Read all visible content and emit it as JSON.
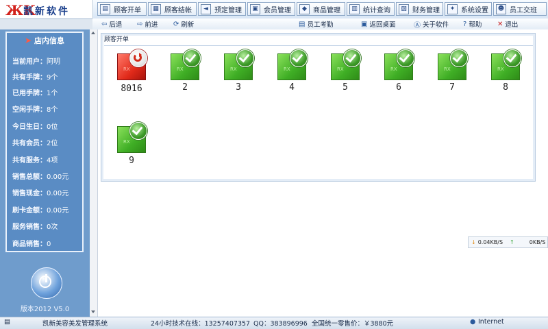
{
  "app": {
    "logo_mark": "ЖK",
    "logo_text": "凯新软件",
    "version": "版本2012 V5.0"
  },
  "top_menu": [
    {
      "label": "顾客开单",
      "icon": "clipboard-icon"
    },
    {
      "label": "顾客结帐",
      "icon": "checkout-icon"
    },
    {
      "label": "预定管理",
      "icon": "speaker-icon"
    },
    {
      "label": "会员管理",
      "icon": "member-card-icon"
    },
    {
      "label": "商品管理",
      "icon": "goods-icon"
    },
    {
      "label": "统计查询",
      "icon": "stats-icon"
    },
    {
      "label": "财务管理",
      "icon": "finance-icon"
    },
    {
      "label": "系统设置",
      "icon": "settings-icon"
    },
    {
      "label": "员工交班",
      "icon": "handover-icon"
    }
  ],
  "sub_toolbar": {
    "back": "后退",
    "forward": "前进",
    "refresh": "刷新",
    "attendance": "员工考勤",
    "home": "返回桌面",
    "about": "关于软件",
    "help": "帮助",
    "exit": "退出"
  },
  "store_info": {
    "title": "店内信息",
    "rows": [
      {
        "key": "当前用户：",
        "value": "阿明"
      },
      {
        "key": "共有手牌：",
        "value": "9个"
      },
      {
        "key": "已用手牌：",
        "value": "1个"
      },
      {
        "key": "空闲手牌：",
        "value": "8个"
      },
      {
        "key": "今日生日：",
        "value": "0位"
      },
      {
        "key": "共有会员：",
        "value": "2位"
      },
      {
        "key": "共有服务：",
        "value": "4项"
      },
      {
        "key": "销售总额：",
        "value": "0.00元"
      },
      {
        "key": "销售现金：",
        "value": "0.00元"
      },
      {
        "key": "刷卡金额：",
        "value": "0.00元"
      },
      {
        "key": "服务销售：",
        "value": "0次"
      },
      {
        "key": "商品销售：",
        "value": "0"
      }
    ]
  },
  "panel": {
    "title": "顾客开单",
    "tiles": [
      {
        "label": "8016",
        "status": "in-use"
      },
      {
        "label": "2",
        "status": "free"
      },
      {
        "label": "3",
        "status": "free"
      },
      {
        "label": "4",
        "status": "free"
      },
      {
        "label": "5",
        "status": "free"
      },
      {
        "label": "6",
        "status": "free"
      },
      {
        "label": "7",
        "status": "free"
      },
      {
        "label": "8",
        "status": "free"
      },
      {
        "label": "9",
        "status": "free"
      }
    ],
    "tile_mark": "RX"
  },
  "speed": {
    "down": "0.04KB/S",
    "up": "0KB/S"
  },
  "status_bar": {
    "app_name": "凯新美容美发管理系统",
    "support": "24小时技术在线：13257407357",
    "qq": "QQ：383896996",
    "price": "全国统一零售价：￥3880元",
    "network": "Internet"
  },
  "colors": {
    "free_tile": "#3fae25",
    "in_use_tile": "#e12a1a",
    "sidebar": "#5a8cc4"
  }
}
